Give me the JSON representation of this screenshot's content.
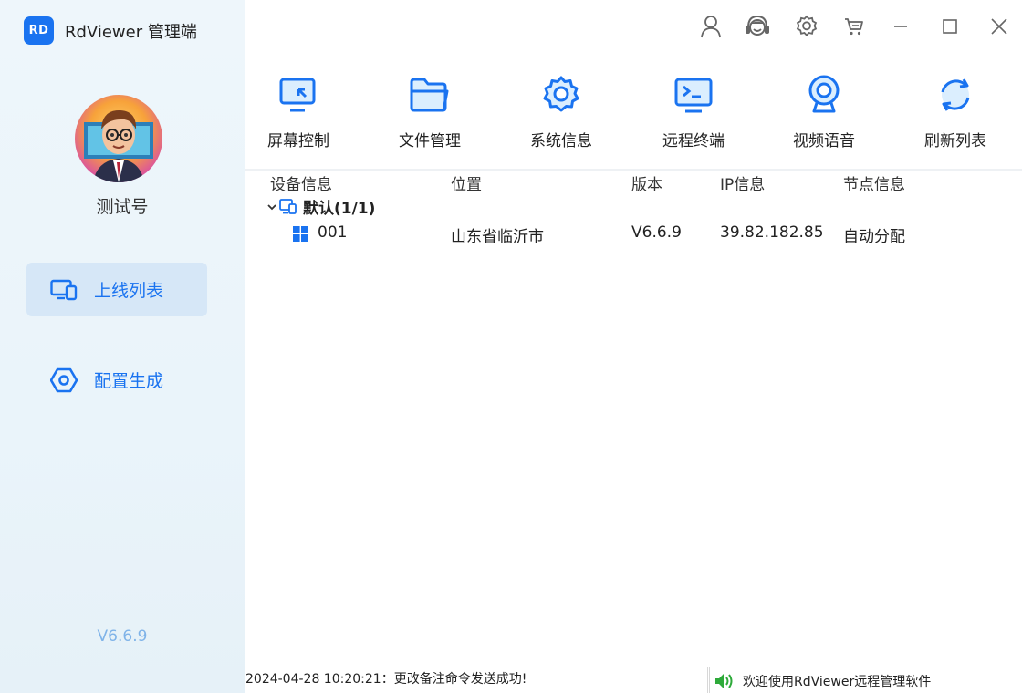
{
  "app": {
    "logo_text": "RD",
    "title": "RdViewer  管理端"
  },
  "user": {
    "name": "测试号"
  },
  "sidebar": {
    "items": [
      {
        "label": "上线列表",
        "icon": "devices-icon",
        "active": true
      },
      {
        "label": "配置生成",
        "icon": "hexagon-settings-icon",
        "active": false
      }
    ],
    "version": "V6.6.9"
  },
  "titlebar": {
    "icons": [
      "user-icon",
      "customer-service-icon",
      "settings-icon",
      "cart-icon",
      "minimize-icon",
      "maximize-icon",
      "close-icon"
    ]
  },
  "toolbar": {
    "items": [
      {
        "label": "屏幕控制",
        "icon": "screen-control-icon"
      },
      {
        "label": "文件管理",
        "icon": "folder-icon"
      },
      {
        "label": "系统信息",
        "icon": "gear-icon"
      },
      {
        "label": "远程终端",
        "icon": "terminal-icon"
      },
      {
        "label": "视频语音",
        "icon": "webcam-icon"
      },
      {
        "label": "刷新列表",
        "icon": "refresh-icon"
      }
    ]
  },
  "table": {
    "columns": [
      "设备信息",
      "位置",
      "版本",
      "IP信息",
      "节点信息"
    ],
    "group": {
      "label": "默认(1/1)"
    },
    "rows": [
      {
        "device": "001",
        "location": "山东省临沂市",
        "version": "V6.6.9",
        "ip": "39.82.182.85",
        "node": "自动分配"
      }
    ]
  },
  "statusbar": {
    "left": "2024-04-28 10:20:21：更改备注命令发送成功!",
    "right": "欢迎使用RdViewer远程管理软件"
  },
  "colors": {
    "accent": "#1a73f0",
    "sidebar_bg": "#eaf4fa",
    "active_item_bg": "#d6e7f7",
    "version_text": "#7fb3e8",
    "speaker_green": "#2eaa3a"
  }
}
